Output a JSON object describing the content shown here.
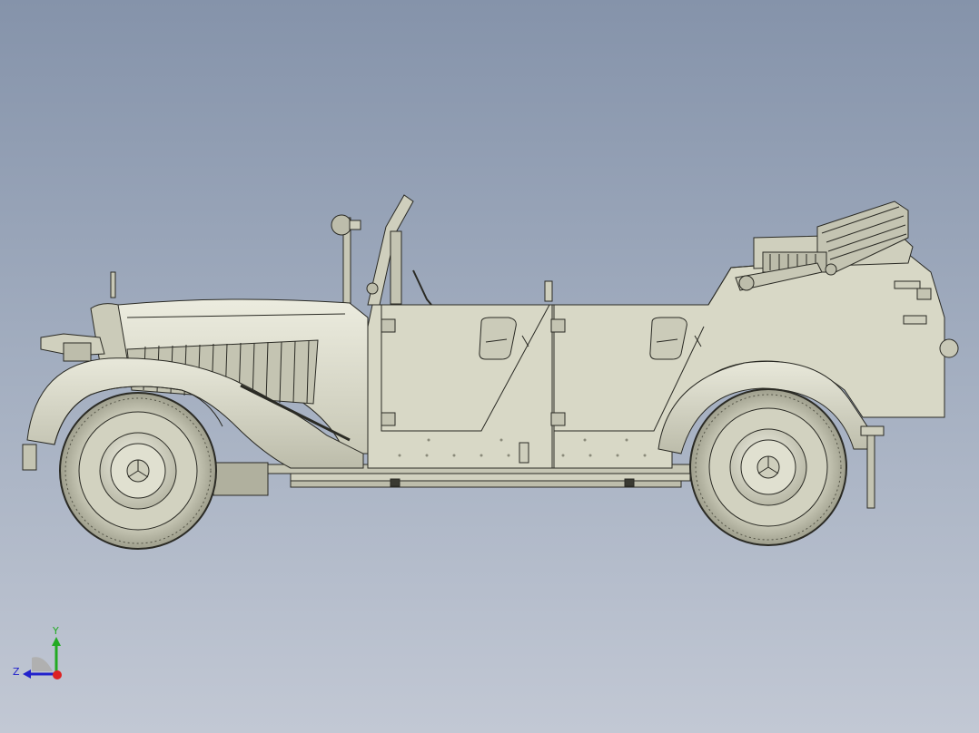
{
  "viewport": {
    "background_top": "#8593aa",
    "background_bottom": "#c2c8d4"
  },
  "model": {
    "body_color": "#d6d6c4",
    "shade_color": "#b6b6a2",
    "line_color": "#2a2a24",
    "tire_color": "#cfcfbd"
  },
  "triad": {
    "y_label": "Y",
    "z_label": "Z",
    "y_color": "#22aa22",
    "z_color": "#2222cc",
    "x_color": "#dd2222"
  }
}
